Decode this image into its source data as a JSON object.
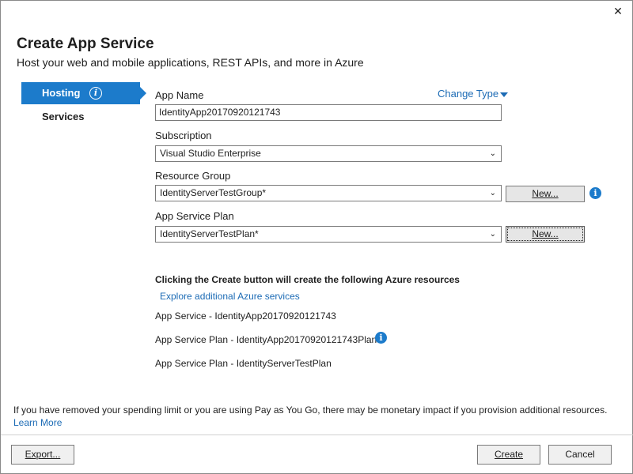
{
  "window": {
    "close_glyph": "✕",
    "title": "Create App Service",
    "subtitle": "Host your web and mobile applications, REST APIs, and more in Azure"
  },
  "nav": {
    "items": [
      {
        "label": "Hosting",
        "selected": true
      },
      {
        "label": "Services",
        "selected": false
      }
    ]
  },
  "form": {
    "app_name": {
      "label": "App Name",
      "value": "IdentityApp20170920121743"
    },
    "change_type": "Change Type",
    "subscription": {
      "label": "Subscription",
      "value": "Visual Studio Enterprise"
    },
    "resource_group": {
      "label": "Resource Group",
      "value": "IdentityServerTestGroup*",
      "new_button": "New..."
    },
    "app_service_plan": {
      "label": "App Service Plan",
      "value": "IdentityServerTestPlan*",
      "new_button": "New..."
    }
  },
  "resources": {
    "heading": "Clicking the Create button will create the following Azure resources",
    "explore_link": "Explore additional Azure services",
    "items": [
      "App Service - IdentityApp20170920121743",
      "App Service Plan - IdentityApp20170920121743Plan",
      "App Service Plan - IdentityServerTestPlan"
    ]
  },
  "footer": {
    "note": "If you have removed your spending limit or you are using Pay as You Go, there may be monetary impact if you provision additional resources.",
    "learn_more": "Learn More",
    "export_button": "Export...",
    "create_button": "Create",
    "cancel_button": "Cancel"
  },
  "colors": {
    "accent": "#1c7bcb",
    "link": "#1c6bb5"
  }
}
